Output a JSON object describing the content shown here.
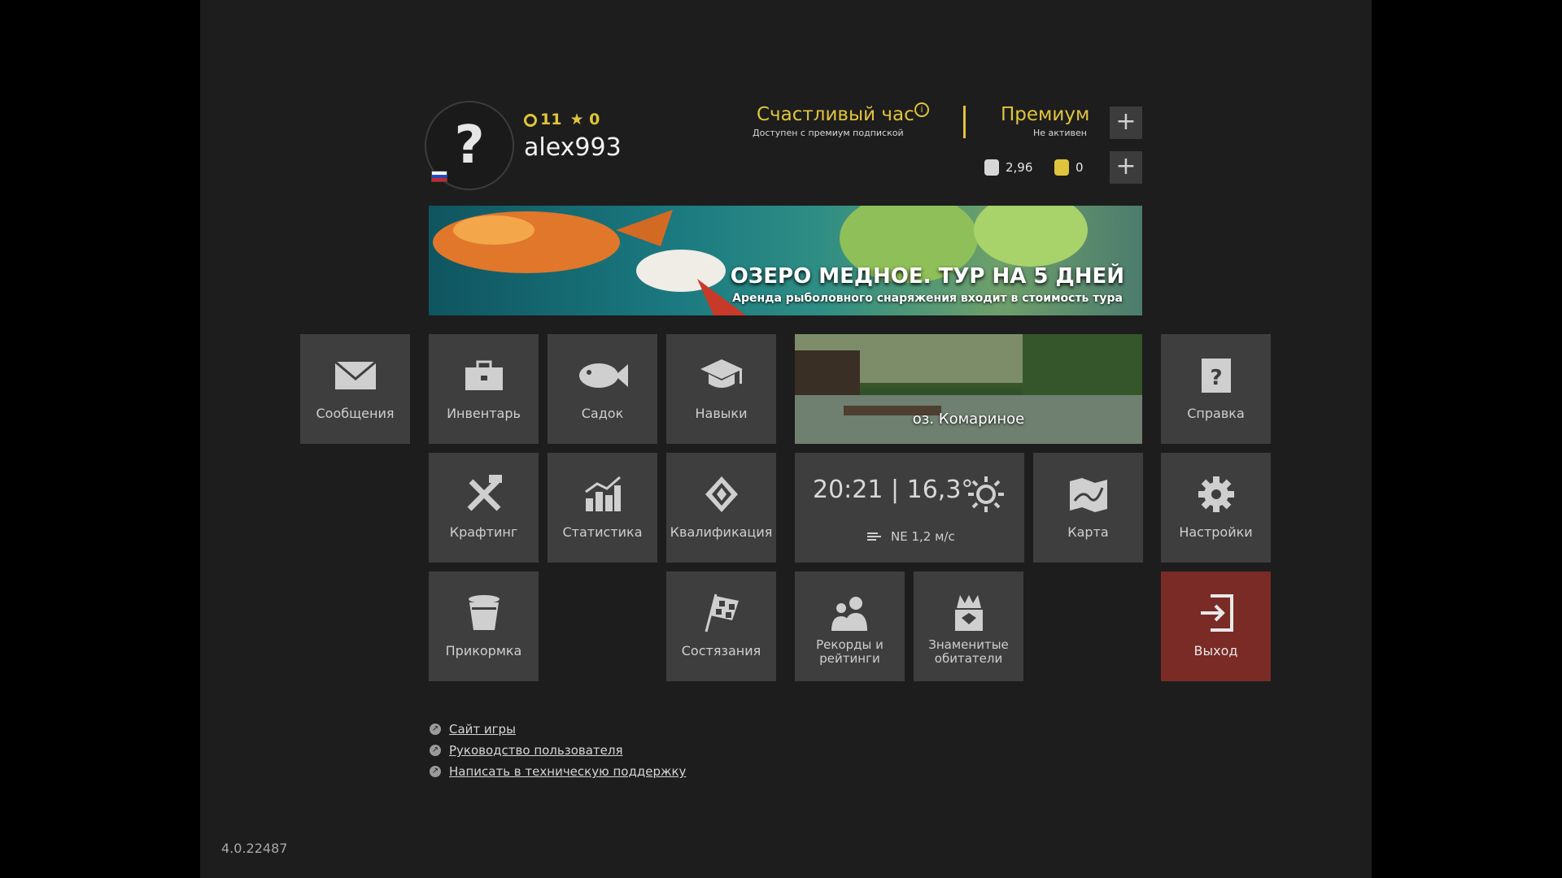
{
  "profile": {
    "avatar_glyph": "?",
    "level": "11",
    "stars": "0",
    "username": "alex993",
    "flag": "ru-flag"
  },
  "happy_hour": {
    "title": "Счастливый час",
    "info_glyph": "i",
    "subtitle": "Доступен с премиум подпиской"
  },
  "premium": {
    "title": "Премиум",
    "status": "Не активен",
    "plus_glyph": "+"
  },
  "currency": {
    "silver": "2,96",
    "gold": "0",
    "plus_glyph": "+"
  },
  "banner": {
    "title": "ОЗЕРО МЕДНОЕ. ТУР НА 5 ДНЕЙ",
    "subtitle": "Аренда рыболовного снаряжения входит в стоимость тура"
  },
  "tiles": {
    "messages": "Сообщения",
    "inventory": "Инвентарь",
    "keepnet": "Садок",
    "skills": "Навыки",
    "help": "Справка",
    "crafting": "Крафтинг",
    "statistics": "Статистика",
    "qualification": "Квалификация",
    "map": "Карта",
    "settings": "Настройки",
    "groundbait": "Прикормка",
    "competitions": "Состязания",
    "records_line1": "Рекорды и",
    "records_line2": "рейтинги",
    "famous_line1": "Знаменитые",
    "famous_line2": "обитатели",
    "exit": "Выход"
  },
  "location": {
    "name": "оз. Комариное"
  },
  "weather": {
    "main": "20:21 | 16,3°",
    "wind": "NE  1,2 м/с",
    "icon": "sun-icon"
  },
  "links": {
    "site": "Сайт игры",
    "guide": "Руководство пользователя",
    "support": "Написать в техническую поддержку"
  },
  "version": "4.0.22487",
  "colors": {
    "accent": "#e0c43c",
    "tile": "#3e3e3e",
    "exit": "#7a2b26",
    "background": "#1d1d1d"
  }
}
